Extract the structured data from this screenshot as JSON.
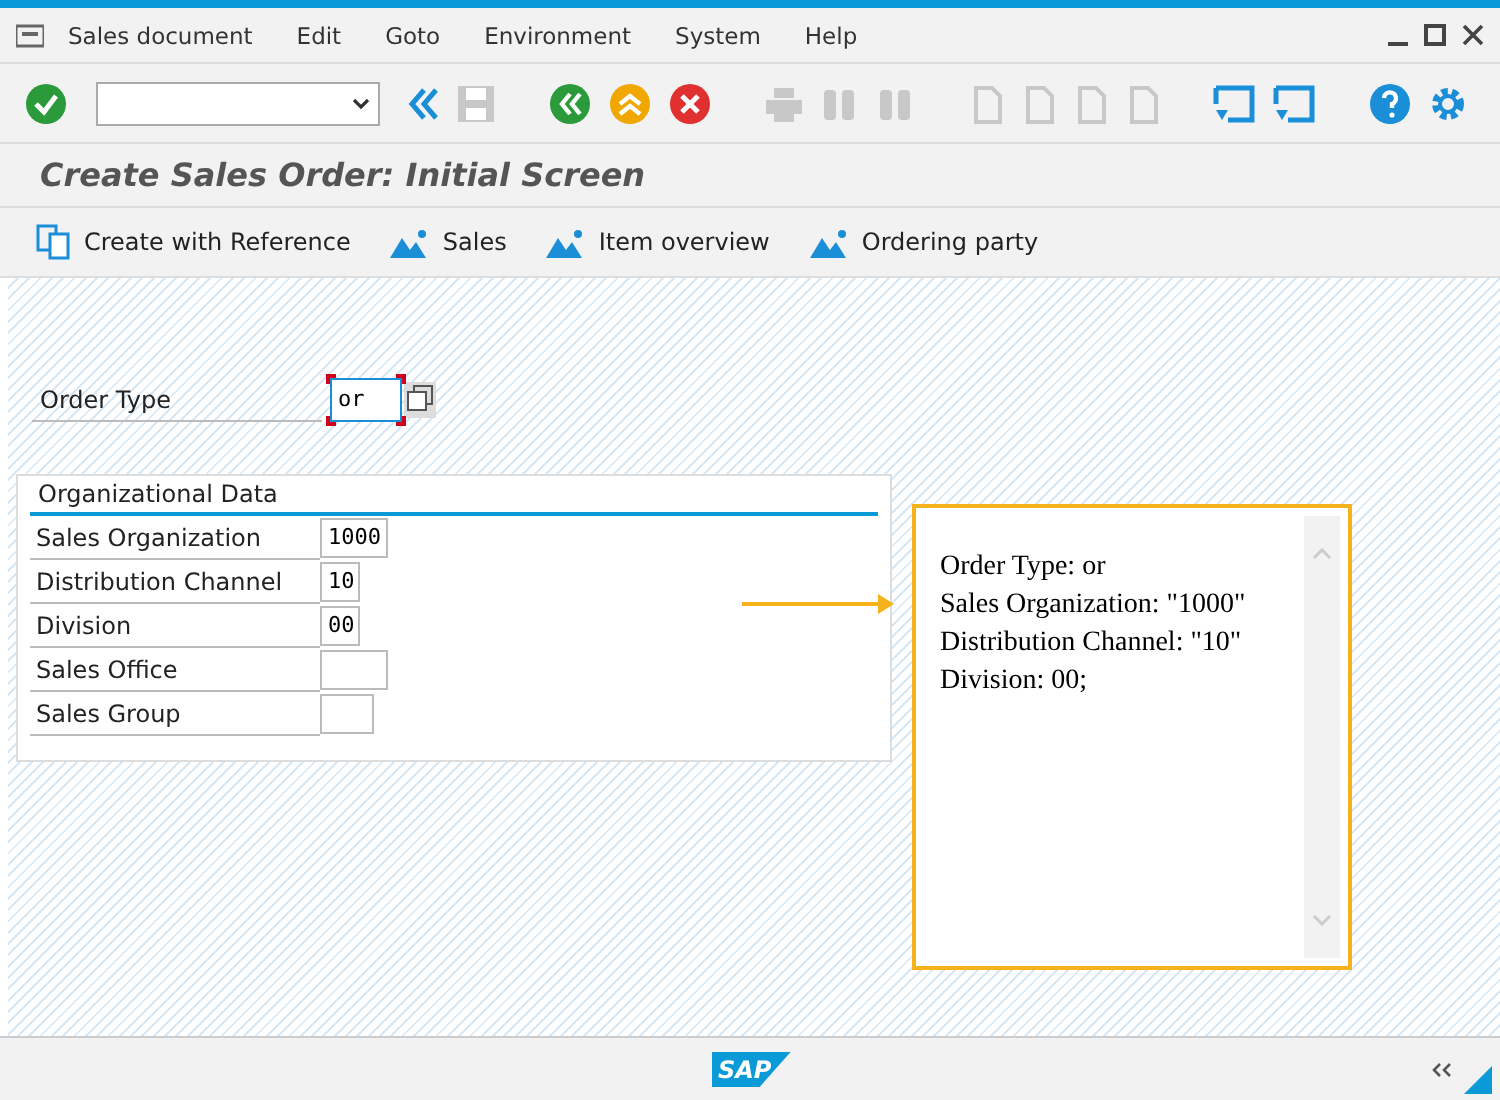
{
  "menu_bar": [
    "Sales document",
    "Edit",
    "Goto",
    "Environment",
    "System",
    "Help"
  ],
  "toolbar": {
    "buttons": [
      {
        "kind": "enter",
        "disabled": false
      },
      {
        "kind": "collapse",
        "disabled": false
      },
      {
        "kind": "save",
        "disabled": true
      },
      {
        "kind": "back",
        "disabled": false
      },
      {
        "kind": "exit",
        "disabled": false
      },
      {
        "kind": "cancel",
        "disabled": false
      },
      {
        "kind": "print",
        "disabled": true
      },
      {
        "kind": "find",
        "disabled": true
      },
      {
        "kind": "find_next",
        "disabled": true
      },
      {
        "kind": "first_page",
        "disabled": true
      },
      {
        "kind": "previous_page",
        "disabled": true
      },
      {
        "kind": "next_page",
        "disabled": true
      },
      {
        "kind": "last_page",
        "disabled": true
      },
      {
        "kind": "new_session",
        "disabled": false
      },
      {
        "kind": "shortcut",
        "disabled": false
      },
      {
        "kind": "help",
        "disabled": false
      },
      {
        "kind": "layout",
        "disabled": false
      }
    ]
  },
  "title": "Create Sales Order: Initial Screen",
  "app_toolbar": [
    {
      "kind": "reference",
      "label": "Create with Reference"
    },
    {
      "kind": "mountain",
      "label": "Sales"
    },
    {
      "kind": "mountain",
      "label": "Item overview"
    },
    {
      "kind": "mountain",
      "label": "Ordering party"
    }
  ],
  "order_type": {
    "label": "Order Type",
    "value": "or",
    "focused": true
  },
  "organizational_data": {
    "title": "Organizational Data",
    "fields": [
      {
        "label": "Sales Organization",
        "value": "1000"
      },
      {
        "label": "Distribution Channel",
        "value": "10"
      },
      {
        "label": "Division",
        "value": "00"
      },
      {
        "label": "Sales Office"
      },
      {
        "label": "Sales Group"
      }
    ]
  },
  "callout": {
    "lines": [
      "Order Type: or",
      "Sales Organization: \"1000\"",
      "Distribution Channel: \"10\"",
      "Division: 00;"
    ]
  },
  "status_bar": {
    "logo": "SAP"
  }
}
